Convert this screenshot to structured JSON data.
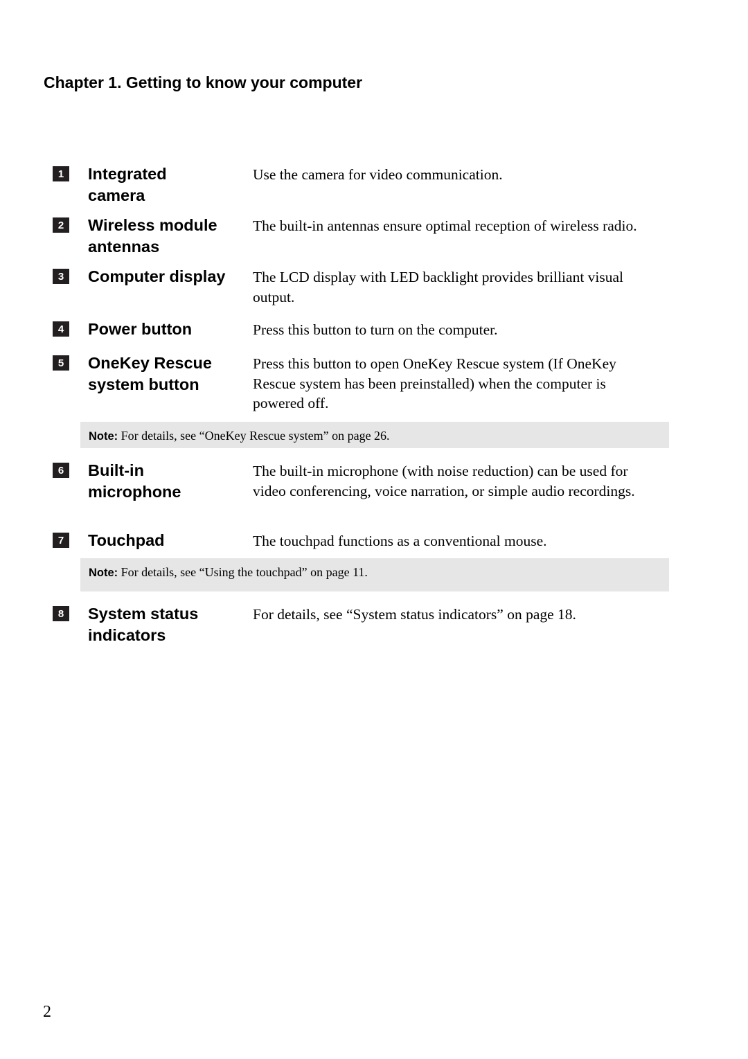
{
  "chapter_title": "Chapter 1. Getting to know your computer",
  "items": [
    {
      "number": "1",
      "term": "Integrated camera",
      "description": "Use the camera for video communication."
    },
    {
      "number": "2",
      "term": "Wireless module antennas",
      "description": "The built-in antennas ensure optimal reception of wireless radio."
    },
    {
      "number": "3",
      "term": "Computer display",
      "description": "The LCD display with LED backlight provides brilliant visual output."
    },
    {
      "number": "4",
      "term": "Power button",
      "description": "Press this button to turn on the computer."
    },
    {
      "number": "5",
      "term": "OneKey Rescue system button",
      "description": "Press this button to open OneKey Rescue system (If OneKey Rescue system has been preinstalled) when the computer is powered off."
    },
    {
      "number": "6",
      "term": "Built-in microphone",
      "description": "The built-in microphone (with noise reduction) can be used for video conferencing, voice narration, or simple audio recordings."
    },
    {
      "number": "7",
      "term": "Touchpad",
      "description": "The touchpad functions as a conventional mouse."
    },
    {
      "number": "8",
      "term": "System status indicators",
      "description": "For details, see “System status indicators” on page 18."
    }
  ],
  "notes": [
    {
      "label": "Note:",
      "text": " For details, see “OneKey Rescue system” on page 26."
    },
    {
      "label": "Note:",
      "text": " For details, see “Using the touchpad” on page 11."
    }
  ],
  "page_number": "2"
}
